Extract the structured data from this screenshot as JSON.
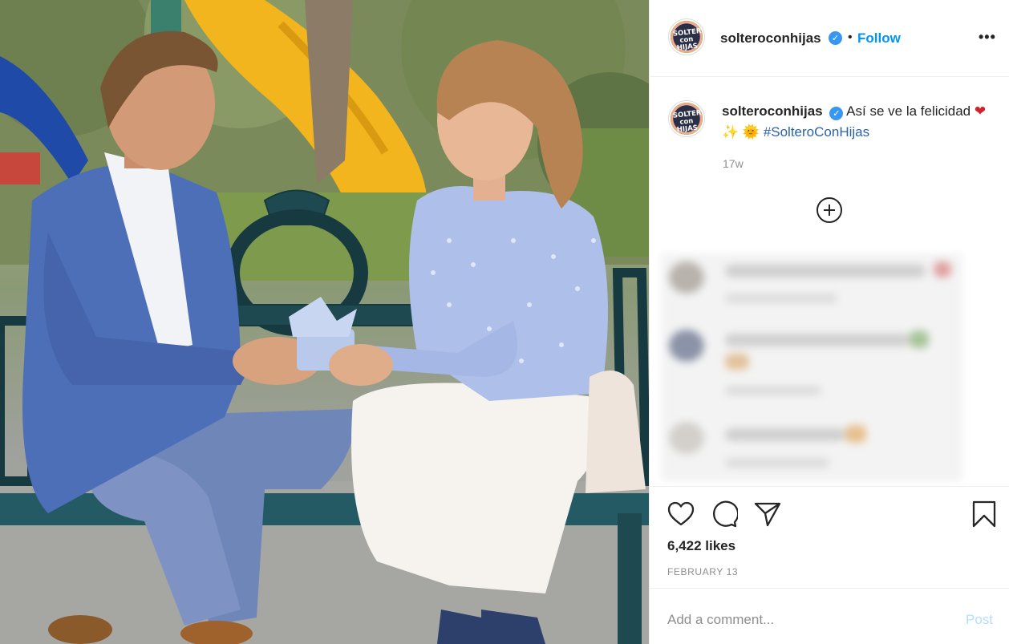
{
  "post": {
    "username": "solteroconhijas",
    "verified_glyph": "✓",
    "separator": "•",
    "follow_label": "Follow",
    "more_label": "•••",
    "avatar_text": "SOLTERO con HIJAS",
    "caption_text": " Así se ve la felicidad ",
    "caption_emojis": [
      "❤",
      "✨",
      "🌞"
    ],
    "hashtag": "#SolteroConHijas",
    "caption_age": "17w",
    "likes": "6,422 likes",
    "date": "FEBRUARY 13"
  },
  "comment_box": {
    "placeholder": "Add a comment...",
    "post_label": "Post"
  },
  "icons": {
    "like": "heart-icon",
    "comment": "comment-icon",
    "share": "share-icon",
    "save": "bookmark-icon",
    "load_more": "plus-circle-icon"
  },
  "colors": {
    "accent": "#0095f6",
    "verified": "#3897f0",
    "muted": "#8e8e8e",
    "post_disabled": "#b2dffc"
  }
}
